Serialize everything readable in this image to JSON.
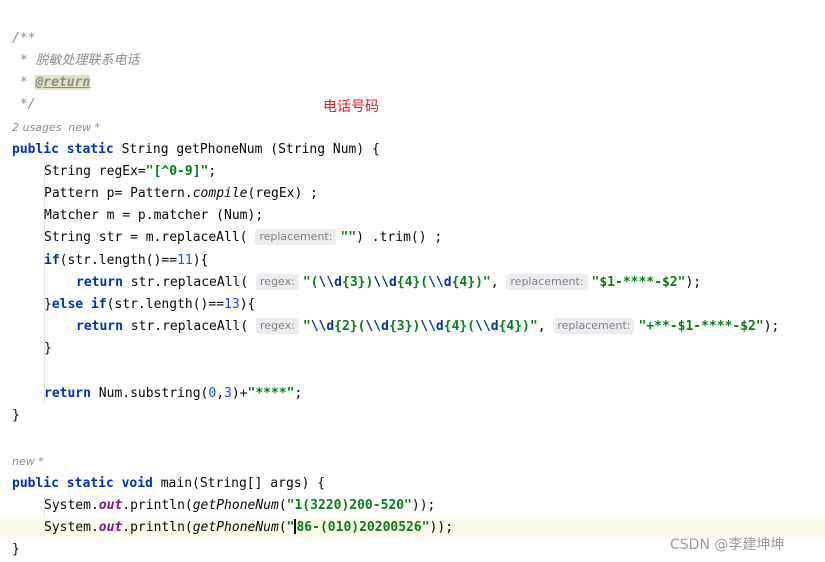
{
  "doc": {
    "open": "/**",
    "desc": " * 脱敏处理联系电话",
    "star": " * ",
    "return_tag": "@return",
    "close": " */"
  },
  "annotation": "电话号码",
  "usage1": "2 usages  new *",
  "usage2": "new *",
  "hints": {
    "replacement": "replacement:",
    "regex": "regex:"
  },
  "code": {
    "sig1": {
      "kw": "public static",
      "rest": " String getPhoneNum (String Num) {"
    },
    "l_regex": {
      "pre": "String regEx=",
      "str": "\"[^0-9]\"",
      "post": ";"
    },
    "l_pattern": {
      "pre": "Pattern p= Pattern.",
      "method": "compile",
      "post": "(regEx) ;"
    },
    "l_matcher": {
      "text": "Matcher m = p.matcher (Num);"
    },
    "l_str": {
      "pre": "String str = m.replaceAll( ",
      "str": "\"\"",
      "post": ") .trim() ;"
    },
    "l_if": {
      "kw": "if",
      "pre": "(str.length()==",
      "num": "11",
      "post": "){"
    },
    "l_ret1": {
      "kw": "return",
      "pre": " str.replaceAll( ",
      "s1": "\"(",
      "e1": "\\\\d",
      "s2": "{3})",
      "e2": "\\\\d",
      "s3": "{4}(",
      "e3": "\\\\d",
      "s4": "{4})\"",
      "mid": ", ",
      "s5": "\"$1-****-$2\"",
      "post": ");"
    },
    "l_else": {
      "pre": "}",
      "kw": "else if",
      "mid": "(str.length()==",
      "num": "13",
      "post": "){"
    },
    "l_ret2": {
      "kw": "return",
      "pre": " str.replaceAll( ",
      "s0": "\"",
      "e0": "\\\\d",
      "s1": "{2}(",
      "e1": "\\\\d",
      "s2": "{3})",
      "e2": "\\\\d",
      "s3": "{4}(",
      "e3": "\\\\d",
      "s4": "{4})\"",
      "mid": ", ",
      "s5": "\"+**-$1-****-$2\"",
      "post": ");"
    },
    "l_close_if": "}",
    "l_ret3": {
      "kw": "return",
      "pre": " Num.substring(",
      "n1": "0",
      "c": ",",
      "n2": "3",
      "mid": ")+",
      "str": "\"****\"",
      "post": ";"
    },
    "l_close1": "}",
    "sig2": {
      "kw1": "public static",
      "sp": " ",
      "kw2": "void",
      "rest": " main(String[] args) {"
    },
    "l_print1": {
      "pre": "System.",
      "field": "out",
      "mid": ".println(",
      "method": "getPhoneNum",
      "p": "(",
      "str": "\"1(3220)200-520\"",
      "post": "));"
    },
    "l_print2": {
      "pre": "System.",
      "field": "out",
      "mid": ".println(",
      "method": "getPhoneNum",
      "p": "(",
      "q": "\"",
      "str": "86-(010)20200526\"",
      "post": "));"
    },
    "l_close2": "}"
  },
  "watermark": "CSDN @李建坤坤",
  "colors": {
    "keyword": "#0033b3",
    "string": "#067d17",
    "number": "#1750eb",
    "comment": "#8c8c8c",
    "field": "#871094",
    "annotation": "#e0201f",
    "current_line": "#fcfaed"
  }
}
